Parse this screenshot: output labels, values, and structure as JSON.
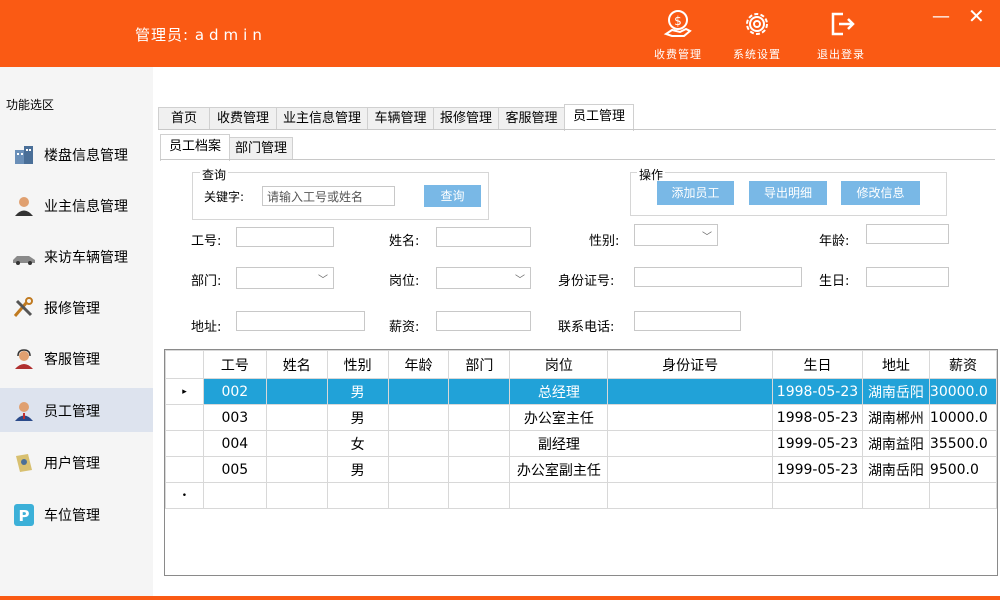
{
  "header": {
    "admin_label": "管理员:",
    "admin_name": "admin",
    "buttons": [
      {
        "label": "收费管理",
        "icon": "money-icon"
      },
      {
        "label": "系统设置",
        "icon": "gear-icon"
      },
      {
        "label": "退出登录",
        "icon": "logout-icon"
      }
    ]
  },
  "sidebar": {
    "title": "功能选区",
    "items": [
      {
        "label": "楼盘信息管理",
        "icon": "building-icon"
      },
      {
        "label": "业主信息管理",
        "icon": "user-icon"
      },
      {
        "label": "来访车辆管理",
        "icon": "car-icon"
      },
      {
        "label": "报修管理",
        "icon": "tools-icon"
      },
      {
        "label": "客服管理",
        "icon": "service-icon"
      },
      {
        "label": "员工管理",
        "icon": "staff-icon"
      },
      {
        "label": "用户管理",
        "icon": "users-icon"
      },
      {
        "label": "车位管理",
        "icon": "parking-icon"
      }
    ],
    "active_index": 5
  },
  "tabs": [
    "首页",
    "收费管理",
    "业主信息管理",
    "车辆管理",
    "报修管理",
    "客服管理",
    "员工管理"
  ],
  "subtabs": [
    "员工档案",
    "部门管理"
  ],
  "query": {
    "title": "查询",
    "keyword_label": "关键字:",
    "keyword_placeholder": "请输入工号或姓名",
    "button": "查询"
  },
  "operations": {
    "title": "操作",
    "buttons": [
      "添加员工",
      "导出明细",
      "修改信息"
    ]
  },
  "form": {
    "id_label": "工号:",
    "name_label": "姓名:",
    "gender_label": "性别:",
    "age_label": "年龄:",
    "dept_label": "部门:",
    "position_label": "岗位:",
    "idcard_label": "身份证号:",
    "birthday_label": "生日:",
    "address_label": "地址:",
    "salary_label": "薪资:",
    "phone_label": "联系电话:"
  },
  "table": {
    "columns": [
      "工号",
      "姓名",
      "性别",
      "年龄",
      "部门",
      "岗位",
      "身份证号",
      "生日",
      "地址",
      "薪资"
    ],
    "rows": [
      {
        "id": "002",
        "gender": "男",
        "position": "总经理",
        "birthday": "1998-05-23",
        "address": "湖南岳阳",
        "salary": "30000.0"
      },
      {
        "id": "003",
        "gender": "男",
        "position": "办公室主任",
        "birthday": "1998-05-23",
        "address": "湖南郴州",
        "salary": "10000.0"
      },
      {
        "id": "004",
        "gender": "女",
        "position": "副经理",
        "birthday": "1999-05-23",
        "address": "湖南益阳",
        "salary": "35500.0"
      },
      {
        "id": "005",
        "gender": "男",
        "position": "办公室副主任",
        "birthday": "1999-05-23",
        "address": "湖南岳阳",
        "salary": "9500.0"
      }
    ],
    "selected_row": 0,
    "current_marker": "▸",
    "new_marker": "•"
  },
  "colors": {
    "header_bg": "#fa5a14",
    "button_blue": "#79b8e6",
    "selection_blue": "#21a2d8",
    "active_side": "#dde3ee"
  }
}
